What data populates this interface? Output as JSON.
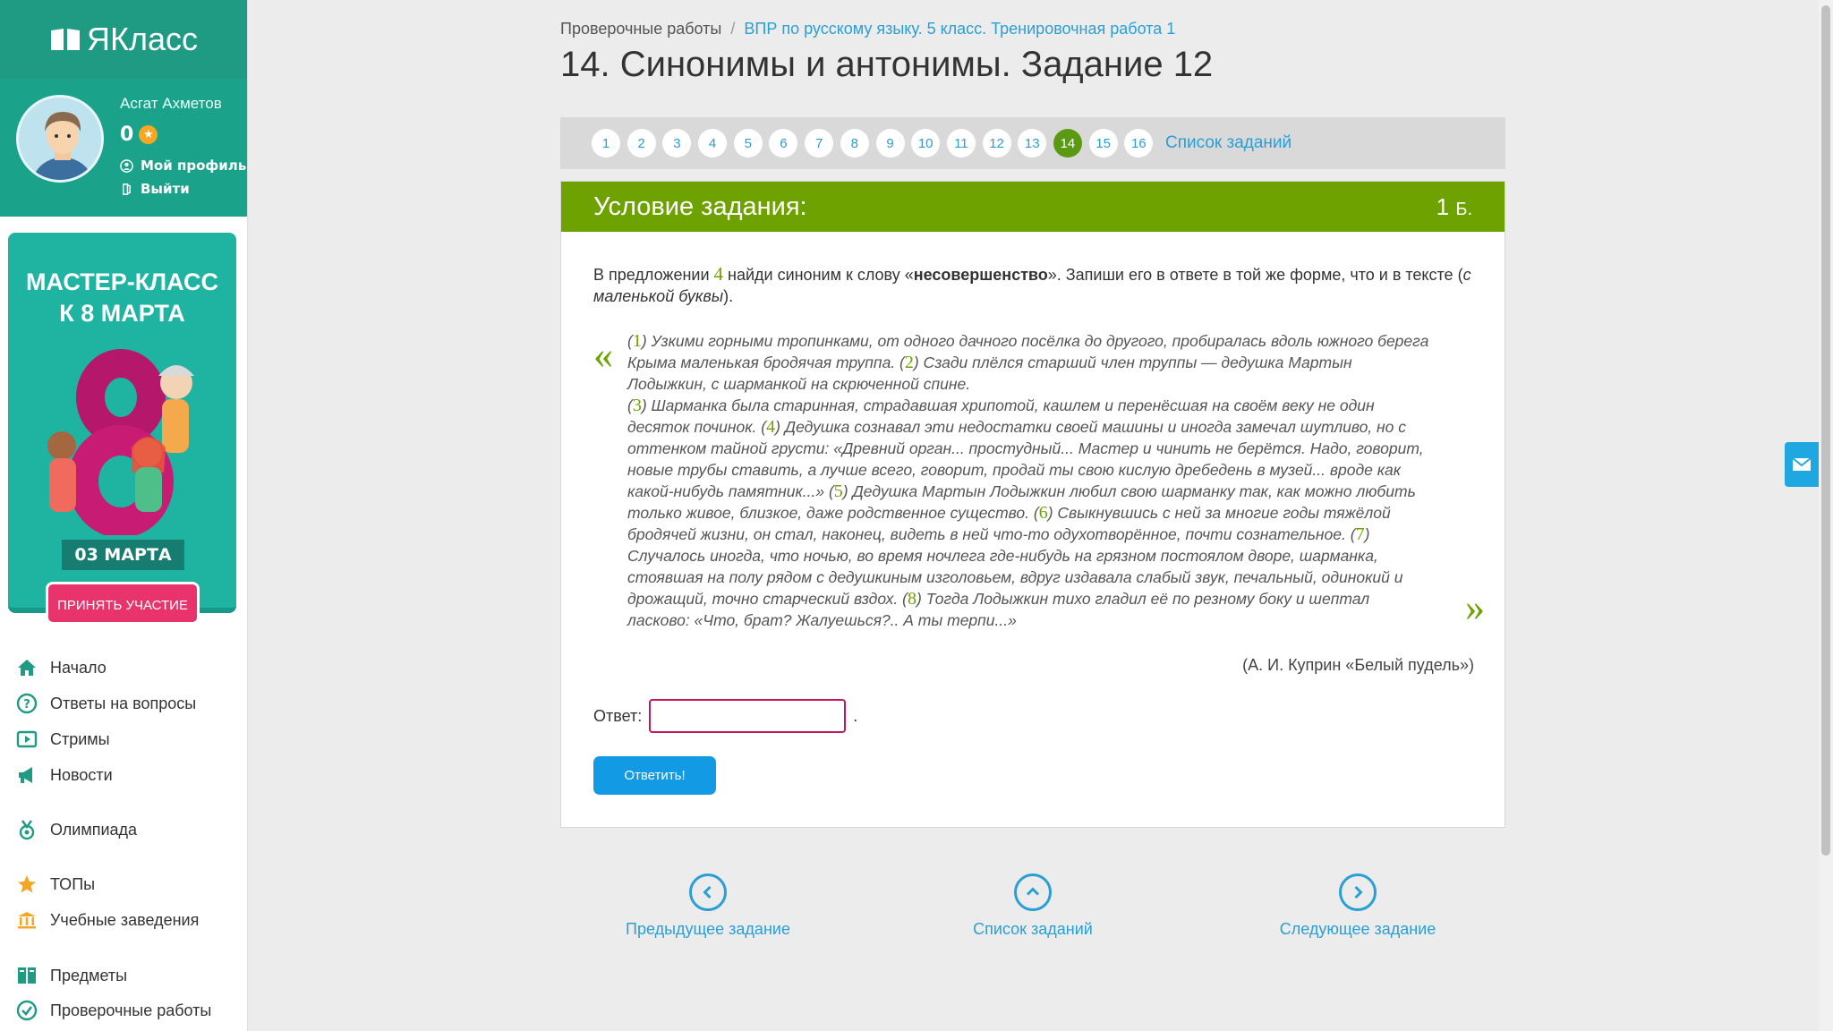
{
  "sidebar": {
    "logo": "ЯКласс",
    "user": {
      "name": "Асгат Ахметов",
      "points": "0"
    },
    "profile_links": [
      "Мой профиль",
      "Выйти"
    ],
    "promo": {
      "title_line1": "МАСТЕР-КЛАСС",
      "title_line2": "К 8 МАРТА",
      "date": "03 МАРТА",
      "button": "ПРИНЯТЬ УЧАСТИЕ"
    },
    "nav": [
      {
        "label": "Начало",
        "icon": "home-icon"
      },
      {
        "label": "Ответы на вопросы",
        "icon": "question-icon"
      },
      {
        "label": "Стримы",
        "icon": "play-icon"
      },
      {
        "label": "Новости",
        "icon": "megaphone-icon"
      },
      {
        "label": "Олимпиада",
        "icon": "medal-icon"
      },
      {
        "label": "ТОПы",
        "icon": "star-icon"
      },
      {
        "label": "Учебные заведения",
        "icon": "school-icon"
      },
      {
        "label": "Предметы",
        "icon": "books-icon"
      },
      {
        "label": "Проверочные работы",
        "icon": "check-icon"
      }
    ]
  },
  "breadcrumb": {
    "root": "Проверочные работы",
    "sep": "/",
    "current": "ВПР по русскому языку. 5 класс. Тренировочная работа 1"
  },
  "page_title": "14. Синонимы и антонимы. Задание 12",
  "pager": {
    "pages": [
      "1",
      "2",
      "3",
      "4",
      "5",
      "6",
      "7",
      "8",
      "9",
      "10",
      "11",
      "12",
      "13",
      "14",
      "15",
      "16"
    ],
    "active": "14",
    "list_label": "Список заданий"
  },
  "task": {
    "header": "Условие задания:",
    "points": "1",
    "points_unit": "Б.",
    "instruction": {
      "p1": "В предложении ",
      "num": "4",
      "p2": " найди синоним к слову «",
      "word": "несовершенство",
      "p3": "». Запиши его в ответе в той же форме, что и в тексте (",
      "italic": "с маленькой буквы",
      "p4": ")."
    },
    "quote_open": "«",
    "quote_close": "»",
    "sentences": [
      {
        "n": "1",
        "text": " Узкими горными тропинками, от одного дачного посёлка до другого, пробиралась вдоль южного берега Крыма маленькая бродячая труппа. "
      },
      {
        "n": "2",
        "text": " Сзади плёлся старший член труппы — дедушка Мартын Лодыжкин, с шарманкой на скрюченной спине."
      },
      {
        "n": "3",
        "text": " Шарманка была старинная, страдавшая хрипотой, кашлем и перенёсшая на своём веку не один десяток починок. "
      },
      {
        "n": "4",
        "text": " Дедушка сознавал эти недостатки своей машины и иногда замечал шутливо, но с оттенком тайной грусти: «Древний орган... простудный... Мастер и чинить не берётся. Надо, говорит, новые трубы ставить, а лучше всего, говорит, продай ты свою кислую дребедень в музей... вроде как какой-нибудь памятник...» "
      },
      {
        "n": "5",
        "text": " Дедушка Мартын Лодыжкин любил свою шарманку так, как можно любить только живое, близкое, даже родственное существо. "
      },
      {
        "n": "6",
        "text": " Свыкнувшись с ней за многие годы тяжёлой бродячей жизни, он стал, наконец, видеть в ней что-то одухотворённое, почти сознательное. "
      },
      {
        "n": "7",
        "text": " Случалось иногда, что ночью, во время ночлега где-нибудь на грязном постоялом дворе, шарманка, стоявшая на полу рядом с дедушкиным изголовьем, вдруг издавала слабый звук, печальный, одинокий и дрожащий, точно старческий вздох. "
      },
      {
        "n": "8",
        "text": " Тогда Лодыжкин тихо гладил её по резному боку и шептал ласково: «Что, брат? Жалуешься?.. А ты терпи...»"
      }
    ],
    "source": "(А. И. Куприн «Белый пудель»)",
    "answer_label": "Ответ:",
    "answer_value": "",
    "answer_suffix": ".",
    "submit": "Ответить!"
  },
  "bottom_nav": {
    "prev": "Предыдущее задание",
    "list": "Список заданий",
    "next": "Следующее задание"
  },
  "colors": {
    "brand_green": "#1e9b82",
    "task_green": "#6ea200",
    "link_blue": "#2a9fd6",
    "button_blue": "#139ae4",
    "promo_pink": "#e8336c"
  }
}
